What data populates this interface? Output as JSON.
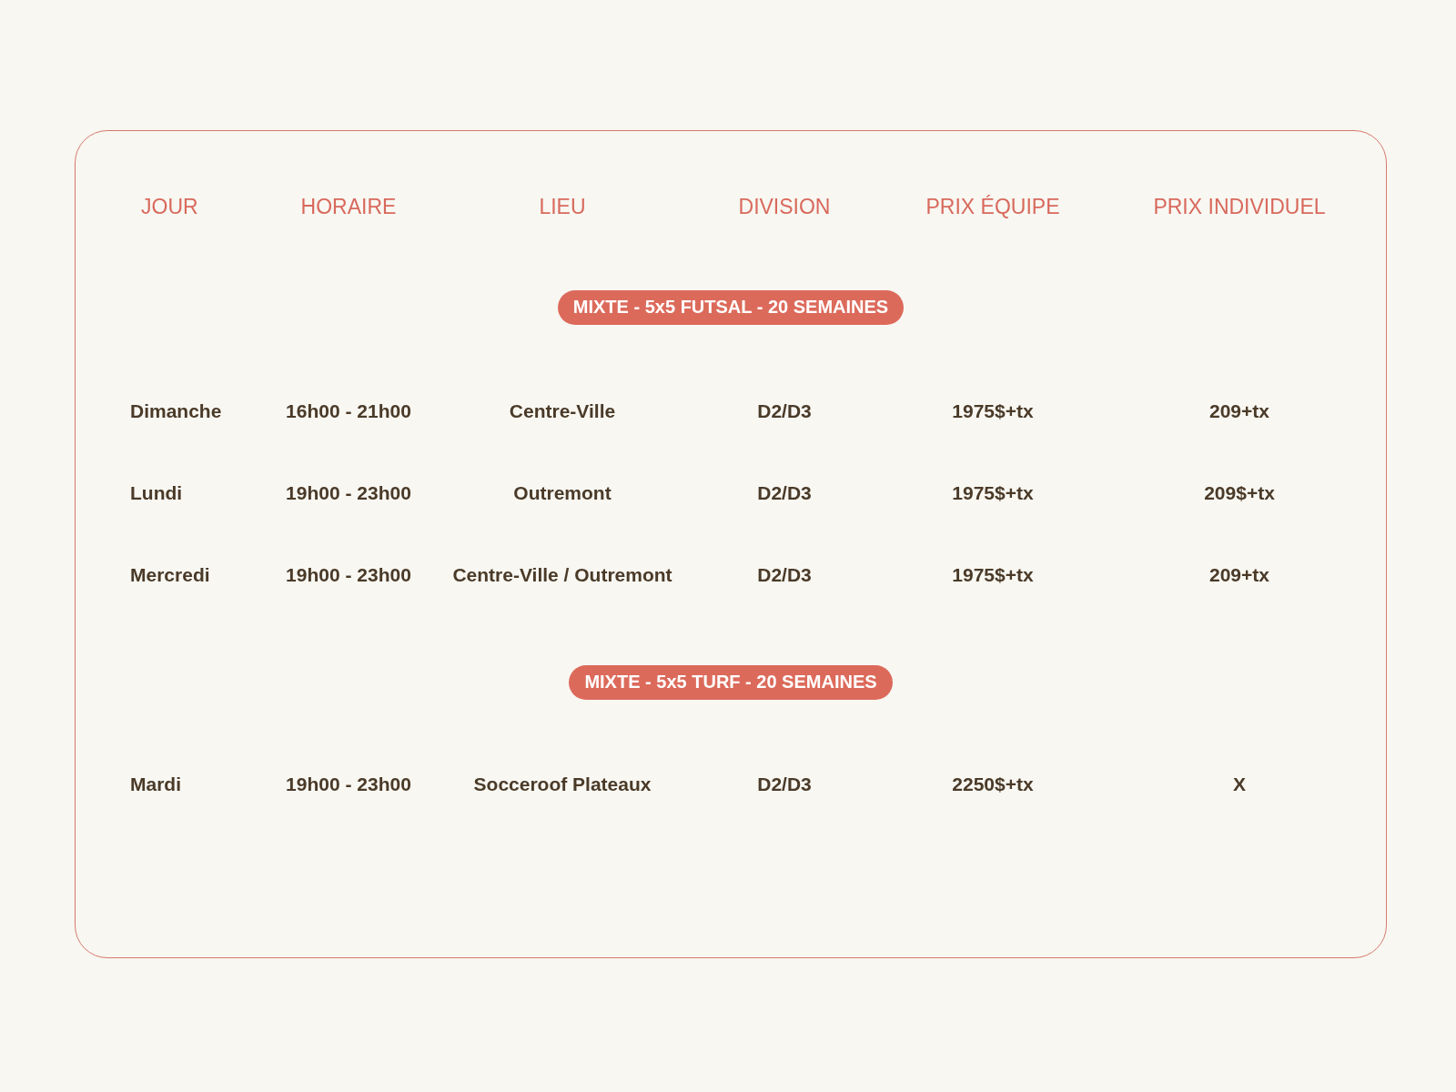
{
  "table": {
    "columns": [
      "JOUR",
      "HORAIRE",
      "LIEU",
      "DIVISION",
      "PRIX ÉQUIPE",
      "PRIX INDIVIDUEL"
    ],
    "sections": [
      {
        "title": "MIXTE - 5x5 FUTSAL - 20 SEMAINES",
        "rows": [
          [
            "Dimanche",
            "16h00 - 21h00",
            "Centre-Ville",
            "D2/D3",
            "1975$+tx",
            "209+tx"
          ],
          [
            "Lundi",
            "19h00 - 23h00",
            "Outremont",
            "D2/D3",
            "1975$+tx",
            "209$+tx"
          ],
          [
            "Mercredi",
            "19h00 - 23h00",
            "Centre-Ville / Outremont",
            "D2/D3",
            "1975$+tx",
            "209+tx"
          ]
        ]
      },
      {
        "title": "MIXTE - 5x5 TURF - 20 SEMAINES",
        "rows": [
          [
            "Mardi",
            "19h00 - 23h00",
            "Socceroof Plateaux",
            "D2/D3",
            "2250$+tx",
            "X"
          ]
        ]
      }
    ]
  }
}
